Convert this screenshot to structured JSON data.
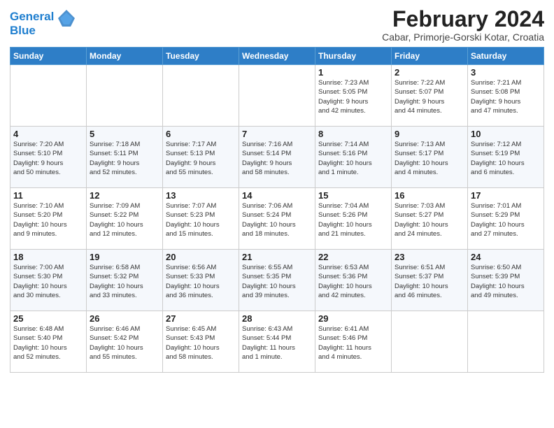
{
  "logo": {
    "line1": "General",
    "line2": "Blue"
  },
  "title": "February 2024",
  "subtitle": "Cabar, Primorje-Gorski Kotar, Croatia",
  "weekdays": [
    "Sunday",
    "Monday",
    "Tuesday",
    "Wednesday",
    "Thursday",
    "Friday",
    "Saturday"
  ],
  "weeks": [
    [
      {
        "day": "",
        "info": ""
      },
      {
        "day": "",
        "info": ""
      },
      {
        "day": "",
        "info": ""
      },
      {
        "day": "",
        "info": ""
      },
      {
        "day": "1",
        "info": "Sunrise: 7:23 AM\nSunset: 5:05 PM\nDaylight: 9 hours\nand 42 minutes."
      },
      {
        "day": "2",
        "info": "Sunrise: 7:22 AM\nSunset: 5:07 PM\nDaylight: 9 hours\nand 44 minutes."
      },
      {
        "day": "3",
        "info": "Sunrise: 7:21 AM\nSunset: 5:08 PM\nDaylight: 9 hours\nand 47 minutes."
      }
    ],
    [
      {
        "day": "4",
        "info": "Sunrise: 7:20 AM\nSunset: 5:10 PM\nDaylight: 9 hours\nand 50 minutes."
      },
      {
        "day": "5",
        "info": "Sunrise: 7:18 AM\nSunset: 5:11 PM\nDaylight: 9 hours\nand 52 minutes."
      },
      {
        "day": "6",
        "info": "Sunrise: 7:17 AM\nSunset: 5:13 PM\nDaylight: 9 hours\nand 55 minutes."
      },
      {
        "day": "7",
        "info": "Sunrise: 7:16 AM\nSunset: 5:14 PM\nDaylight: 9 hours\nand 58 minutes."
      },
      {
        "day": "8",
        "info": "Sunrise: 7:14 AM\nSunset: 5:16 PM\nDaylight: 10 hours\nand 1 minute."
      },
      {
        "day": "9",
        "info": "Sunrise: 7:13 AM\nSunset: 5:17 PM\nDaylight: 10 hours\nand 4 minutes."
      },
      {
        "day": "10",
        "info": "Sunrise: 7:12 AM\nSunset: 5:19 PM\nDaylight: 10 hours\nand 6 minutes."
      }
    ],
    [
      {
        "day": "11",
        "info": "Sunrise: 7:10 AM\nSunset: 5:20 PM\nDaylight: 10 hours\nand 9 minutes."
      },
      {
        "day": "12",
        "info": "Sunrise: 7:09 AM\nSunset: 5:22 PM\nDaylight: 10 hours\nand 12 minutes."
      },
      {
        "day": "13",
        "info": "Sunrise: 7:07 AM\nSunset: 5:23 PM\nDaylight: 10 hours\nand 15 minutes."
      },
      {
        "day": "14",
        "info": "Sunrise: 7:06 AM\nSunset: 5:24 PM\nDaylight: 10 hours\nand 18 minutes."
      },
      {
        "day": "15",
        "info": "Sunrise: 7:04 AM\nSunset: 5:26 PM\nDaylight: 10 hours\nand 21 minutes."
      },
      {
        "day": "16",
        "info": "Sunrise: 7:03 AM\nSunset: 5:27 PM\nDaylight: 10 hours\nand 24 minutes."
      },
      {
        "day": "17",
        "info": "Sunrise: 7:01 AM\nSunset: 5:29 PM\nDaylight: 10 hours\nand 27 minutes."
      }
    ],
    [
      {
        "day": "18",
        "info": "Sunrise: 7:00 AM\nSunset: 5:30 PM\nDaylight: 10 hours\nand 30 minutes."
      },
      {
        "day": "19",
        "info": "Sunrise: 6:58 AM\nSunset: 5:32 PM\nDaylight: 10 hours\nand 33 minutes."
      },
      {
        "day": "20",
        "info": "Sunrise: 6:56 AM\nSunset: 5:33 PM\nDaylight: 10 hours\nand 36 minutes."
      },
      {
        "day": "21",
        "info": "Sunrise: 6:55 AM\nSunset: 5:35 PM\nDaylight: 10 hours\nand 39 minutes."
      },
      {
        "day": "22",
        "info": "Sunrise: 6:53 AM\nSunset: 5:36 PM\nDaylight: 10 hours\nand 42 minutes."
      },
      {
        "day": "23",
        "info": "Sunrise: 6:51 AM\nSunset: 5:37 PM\nDaylight: 10 hours\nand 46 minutes."
      },
      {
        "day": "24",
        "info": "Sunrise: 6:50 AM\nSunset: 5:39 PM\nDaylight: 10 hours\nand 49 minutes."
      }
    ],
    [
      {
        "day": "25",
        "info": "Sunrise: 6:48 AM\nSunset: 5:40 PM\nDaylight: 10 hours\nand 52 minutes."
      },
      {
        "day": "26",
        "info": "Sunrise: 6:46 AM\nSunset: 5:42 PM\nDaylight: 10 hours\nand 55 minutes."
      },
      {
        "day": "27",
        "info": "Sunrise: 6:45 AM\nSunset: 5:43 PM\nDaylight: 10 hours\nand 58 minutes."
      },
      {
        "day": "28",
        "info": "Sunrise: 6:43 AM\nSunset: 5:44 PM\nDaylight: 11 hours\nand 1 minute."
      },
      {
        "day": "29",
        "info": "Sunrise: 6:41 AM\nSunset: 5:46 PM\nDaylight: 11 hours\nand 4 minutes."
      },
      {
        "day": "",
        "info": ""
      },
      {
        "day": "",
        "info": ""
      }
    ]
  ]
}
